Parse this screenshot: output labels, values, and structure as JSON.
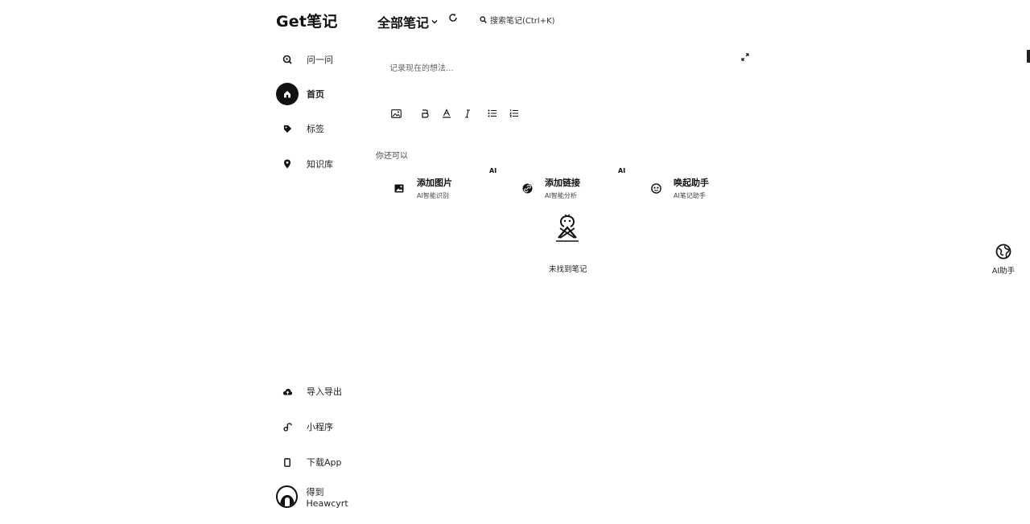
{
  "brand": {
    "logo_text": "Get笔记"
  },
  "sidebar": {
    "items": [
      {
        "label": "问一问",
        "icon": "search-chat-icon"
      },
      {
        "label": "首页",
        "icon": "home-icon"
      },
      {
        "label": "标签",
        "icon": "tag-icon"
      },
      {
        "label": "知识库",
        "icon": "location-pin-icon"
      }
    ],
    "bottom_items": [
      {
        "label": "导入导出",
        "icon": "cloud-upload-icon"
      },
      {
        "label": "小程序",
        "icon": "mini-program-icon"
      },
      {
        "label": "下载App",
        "icon": "phone-icon"
      }
    ],
    "user": {
      "name": "得到Heawcyrt"
    }
  },
  "header": {
    "title": "全部笔记",
    "search_placeholder": "搜索笔记(Ctrl+K)"
  },
  "editor": {
    "placeholder": "记录现在的想法..."
  },
  "quick_actions": {
    "label": "你还可以",
    "ai_badge": "AI",
    "items": [
      {
        "title": "添加图片",
        "subtitle": "AI智能识别",
        "icon": "image-icon",
        "ai": true
      },
      {
        "title": "添加链接",
        "subtitle": "AI智能分析",
        "icon": "link-icon",
        "ai": true
      },
      {
        "title": "唤起助手",
        "subtitle": "AI笔记助手",
        "icon": "assistant-icon",
        "ai": false
      }
    ]
  },
  "empty_state": {
    "text": "未找到笔记"
  },
  "ai_assistant": {
    "label": "AI助手"
  },
  "colors": {
    "accent": "#111111",
    "background": "#ffffff"
  }
}
